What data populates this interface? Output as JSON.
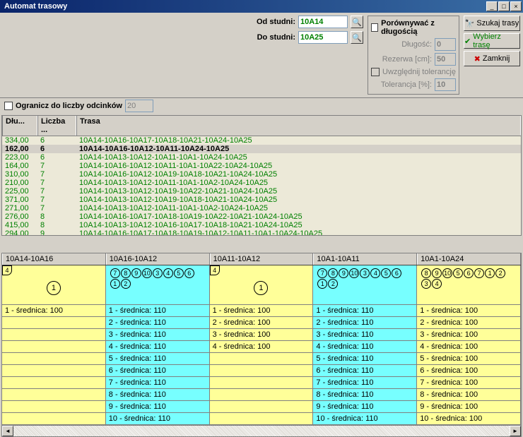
{
  "title": "Automat trasowy",
  "labels": {
    "od": "Od studni:",
    "do": "Do studni:",
    "cmp": "Porównywać z  długością",
    "dlug": "Długość:",
    "rez": "Rezerwa [cm]:",
    "uwz": "Uwzględnij tolerancję",
    "tol": "Tolerancja [%]:",
    "seg": "Ogranicz do liczby odcinków"
  },
  "inputs": {
    "od": "10A14",
    "do": "10A25",
    "dlug": "0",
    "rez": "50",
    "tol": "10",
    "seg": "20"
  },
  "buttons": {
    "szukaj": "Szukaj trasy",
    "wybierz": "Wybierz trasę",
    "zamknij": "Zamknij"
  },
  "grid": {
    "headers": [
      "Dłu...",
      "Liczba ...",
      "Trasa"
    ],
    "rows": [
      {
        "d": "334,00",
        "n": "6",
        "t": "10A14-10A16-10A17-10A18-10A21-10A24-10A25",
        "sel": false
      },
      {
        "d": "162,00",
        "n": "6",
        "t": "10A14-10A16-10A12-10A11-10A24-10A25",
        "sel": true
      },
      {
        "d": "223,00",
        "n": "6",
        "t": "10A14-10A13-10A12-10A11-10A1-10A24-10A25",
        "sel": false
      },
      {
        "d": "164,00",
        "n": "7",
        "t": "10A14-10A16-10A12-10A11-10A1-10A22-10A24-10A25",
        "sel": false
      },
      {
        "d": "310,00",
        "n": "7",
        "t": "10A14-10A16-10A12-10A19-10A18-10A21-10A24-10A25",
        "sel": false
      },
      {
        "d": "210,00",
        "n": "7",
        "t": "10A14-10A13-10A12-10A11-10A1-10A2-10A24-10A25",
        "sel": false
      },
      {
        "d": "225,00",
        "n": "7",
        "t": "10A14-10A13-10A12-10A19-10A22-10A21-10A24-10A25",
        "sel": false
      },
      {
        "d": "371,00",
        "n": "7",
        "t": "10A14-10A13-10A12-10A19-10A18-10A21-10A24-10A25",
        "sel": false
      },
      {
        "d": "271,00",
        "n": "7",
        "t": "10A14-10A13-10A12-10A11-10A1-10A2-10A24-10A25",
        "sel": false
      },
      {
        "d": "276,00",
        "n": "8",
        "t": "10A14-10A16-10A17-10A18-10A19-10A22-10A21-10A24-10A25",
        "sel": false
      },
      {
        "d": "415,00",
        "n": "8",
        "t": "10A14-10A13-10A12-10A16-10A17-10A18-10A21-10A24-10A25",
        "sel": false
      },
      {
        "d": "294,00",
        "n": "9",
        "t": "10A14-10A16-10A17-10A18-10A19-10A12-10A11-10A1-10A24-10A25",
        "sel": false
      }
    ]
  },
  "bottom": {
    "headers": [
      "10A14-10A16",
      "10A16-10A12",
      "10A11-10A12",
      "10A1-10A11",
      "10A1-10A24"
    ],
    "cols": [
      {
        "corner": "4",
        "circles": [],
        "big": "1",
        "rows": [
          "1 - średnica: 100",
          "",
          "",
          "",
          "",
          "",
          "",
          "",
          "",
          ""
        ],
        "color": "y"
      },
      {
        "corner": "",
        "circles": [
          "7",
          "8",
          "9",
          "10",
          "3",
          "4",
          "5",
          "6",
          "1",
          "2"
        ],
        "big": "",
        "rows": [
          "1 - średnica: 110",
          "2 - średnica: 110",
          "3 - średnica: 110",
          "4 - średnica: 110",
          "5 - średnica: 110",
          "6 - średnica: 110",
          "7 - średnica: 110",
          "8 - średnica: 110",
          "9 - średnica: 110",
          "10 - średnica: 110"
        ],
        "color": "c"
      },
      {
        "corner": "4",
        "circles": [],
        "big": "1",
        "rows": [
          "1 - średnica: 100",
          "2 - średnica: 100",
          "3 - średnica: 100",
          "4 - średnica: 100",
          "",
          "",
          "",
          "",
          "",
          ""
        ],
        "color": "y"
      },
      {
        "corner": "",
        "circles": [
          "7",
          "8",
          "9",
          "10",
          "3",
          "4",
          "5",
          "6",
          "1",
          "2"
        ],
        "big": "",
        "rows": [
          "1 - średnica: 110",
          "2 - średnica: 110",
          "3 - średnica: 110",
          "4 - średnica: 110",
          "5 - średnica: 110",
          "6 - średnica: 110",
          "7 - średnica: 110",
          "8 - średnica: 110",
          "9 - średnica: 110",
          "10 - średnica: 110"
        ],
        "color": "c"
      },
      {
        "corner": "",
        "circles": [
          "8",
          "9",
          "10",
          "5",
          "6",
          "7",
          "1",
          "2",
          "3",
          "4"
        ],
        "big": "",
        "rows": [
          "1 - średnica: 100",
          "2 - średnica: 100",
          "3 - średnica: 100",
          "4 - średnica: 100",
          "5 - średnica: 100",
          "6 - średnica: 100",
          "7 - średnica: 100",
          "8 - średnica: 100",
          "9 - średnica: 100",
          "10 - średnica: 100"
        ],
        "color": "y"
      }
    ]
  }
}
